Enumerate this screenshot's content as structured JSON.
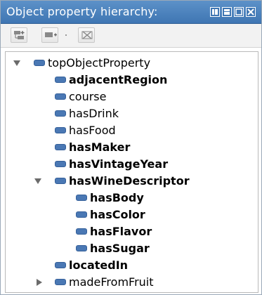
{
  "panel": {
    "title": "Object property hierarchy:"
  },
  "icons": {
    "toolbar": [
      "add-subproperty-icon",
      "add-sibling-property-icon",
      "delete-property-icon"
    ],
    "window_controls": [
      "restore-icon",
      "split-icon",
      "maximize-icon",
      "close-icon"
    ]
  },
  "colors": {
    "title_bar": "#4a80bd",
    "property_bullet": "#4a78b4"
  },
  "tree": {
    "root": {
      "label": "topObjectProperty",
      "expanded": true
    },
    "items": [
      {
        "label": "adjacentRegion",
        "bold": true
      },
      {
        "label": "course",
        "bold": false
      },
      {
        "label": "hasDrink",
        "bold": false
      },
      {
        "label": "hasFood",
        "bold": false
      },
      {
        "label": "hasMaker",
        "bold": true
      },
      {
        "label": "hasVintageYear",
        "bold": true
      },
      {
        "label": "hasWineDescriptor",
        "bold": true,
        "expanded": true,
        "children": [
          {
            "label": "hasBody",
            "bold": true
          },
          {
            "label": "hasColor",
            "bold": true
          },
          {
            "label": "hasFlavor",
            "bold": true
          },
          {
            "label": "hasSugar",
            "bold": true
          }
        ]
      },
      {
        "label": "locatedIn",
        "bold": true
      },
      {
        "label": "madeFromFruit",
        "bold": false,
        "expanded": false
      }
    ]
  }
}
